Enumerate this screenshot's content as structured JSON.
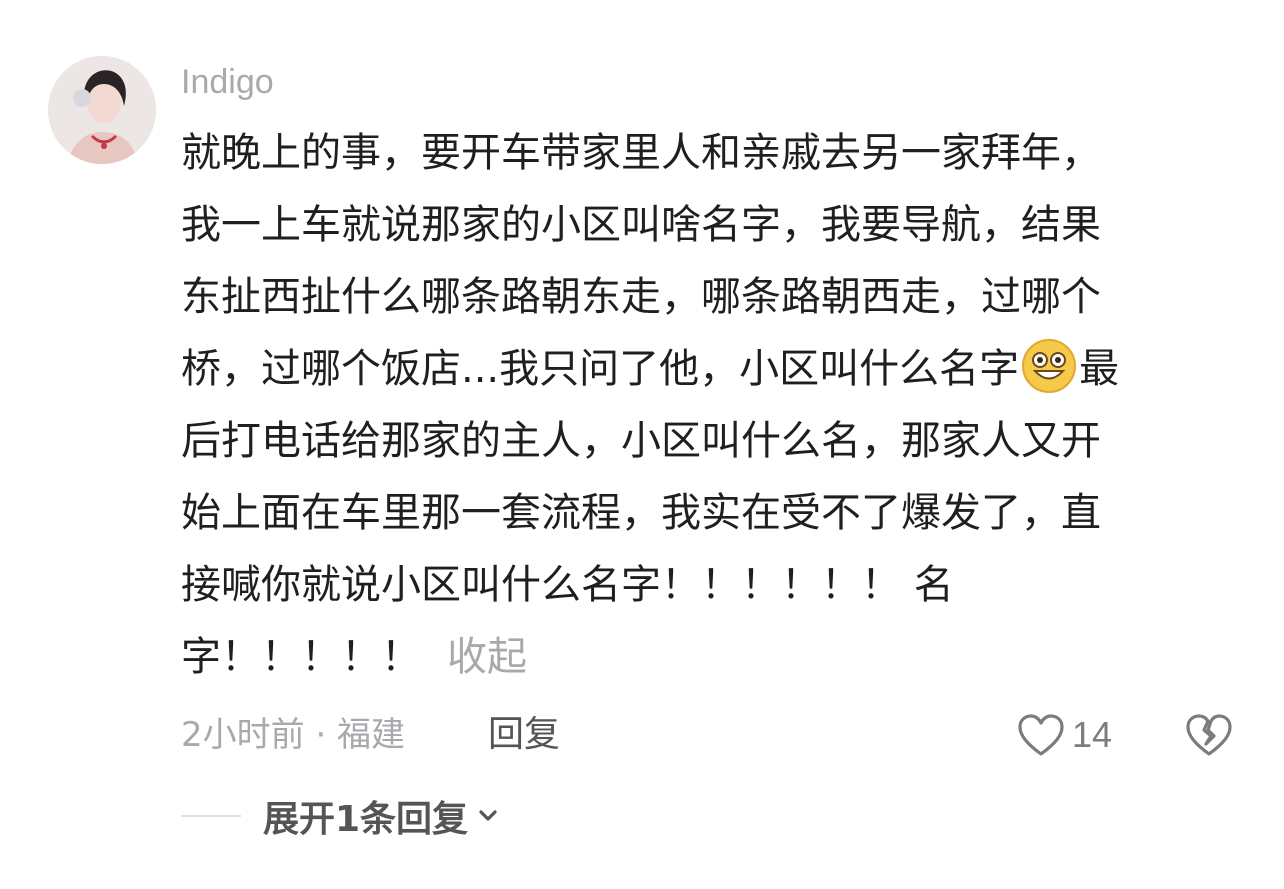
{
  "comment": {
    "username": "Indigo",
    "lines": [
      "就晚上的事，要开车带家里人和亲戚去另一家拜年，",
      "我一上车就说那家的小区叫啥名字，我要导航，结果",
      "东扯西扯什么哪条路朝东走，哪条路朝西走，过哪个",
      "桥，过哪个饭店...我只问了他，小区叫什么名字",
      "后打电话给那家的主人，小区叫什么名，那家人又开",
      "始上面在车里那一套流程，我实在受不了爆发了，直",
      "接喊你就说小区叫什么名字！！！！！！ 名",
      "字！！！！！"
    ],
    "line4_tail": "最",
    "emoji_icon": "grinning-emoji",
    "collapse_label": "收起",
    "meta": "2小时前 · 福建",
    "reply_label": "回复",
    "like_count": "14",
    "expand_label": "展开1条回复"
  },
  "colors": {
    "text": "#1f1f22",
    "muted": "#a9a9ad",
    "action": "#555558"
  }
}
